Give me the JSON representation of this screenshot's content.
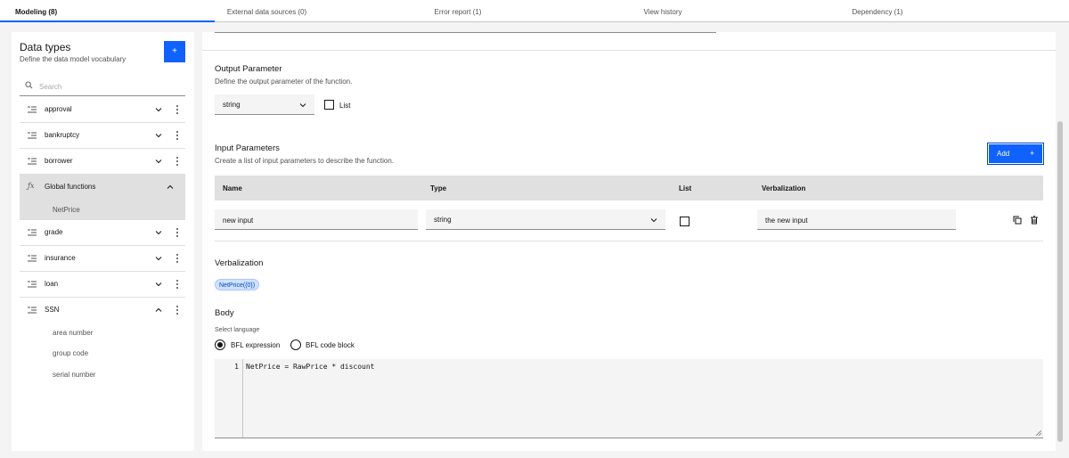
{
  "tabs": [
    {
      "label": "Modeling (8)",
      "active": true
    },
    {
      "label": "External data sources (0)"
    },
    {
      "label": "Error report (1)"
    },
    {
      "label": "View history"
    },
    {
      "label": "Dependency (1)"
    }
  ],
  "sidebar": {
    "title": "Data types",
    "subtitle": "Define the data model vocabulary",
    "add_label": "+",
    "search_placeholder": "Search",
    "items": [
      {
        "label": "approval",
        "icon": "type-icon"
      },
      {
        "label": "bankruptcy",
        "icon": "type-icon"
      },
      {
        "label": "borrower",
        "icon": "type-icon"
      },
      {
        "label": "Global functions",
        "icon": "function-icon",
        "expanded": true,
        "children": [
          "NetPrice"
        ]
      },
      {
        "label": "grade",
        "icon": "type-icon"
      },
      {
        "label": "insurance",
        "icon": "type-icon"
      },
      {
        "label": "loan",
        "icon": "type-icon"
      },
      {
        "label": "SSN",
        "icon": "type-icon",
        "expanded": true,
        "children": [
          "area number",
          "group code",
          "serial number"
        ]
      }
    ]
  },
  "output": {
    "title": "Output Parameter",
    "subtitle": "Define the output parameter of the function.",
    "type_value": "string",
    "list_label": "List"
  },
  "input": {
    "title": "Input Parameters",
    "subtitle": "Create a list of input parameters to describe the function.",
    "add_label": "Add",
    "add_icon": "+",
    "columns": [
      "Name",
      "Type",
      "List",
      "Verbalization"
    ],
    "rows": [
      {
        "name": "new input",
        "type": "string",
        "list": false,
        "verbalization": "the new input"
      }
    ]
  },
  "verbalization": {
    "title": "Verbalization",
    "tag": "NetPrice({0})"
  },
  "body": {
    "title": "Body",
    "language_label": "Select language",
    "options": [
      {
        "label": "BFL expression",
        "checked": true
      },
      {
        "label": "BFL code block",
        "checked": false
      }
    ],
    "line_number": "1",
    "code": "NetPrice = RawPrice * discount"
  },
  "colors": {
    "accent": "#0f62fe",
    "tag_bg": "#d0e2ff"
  }
}
